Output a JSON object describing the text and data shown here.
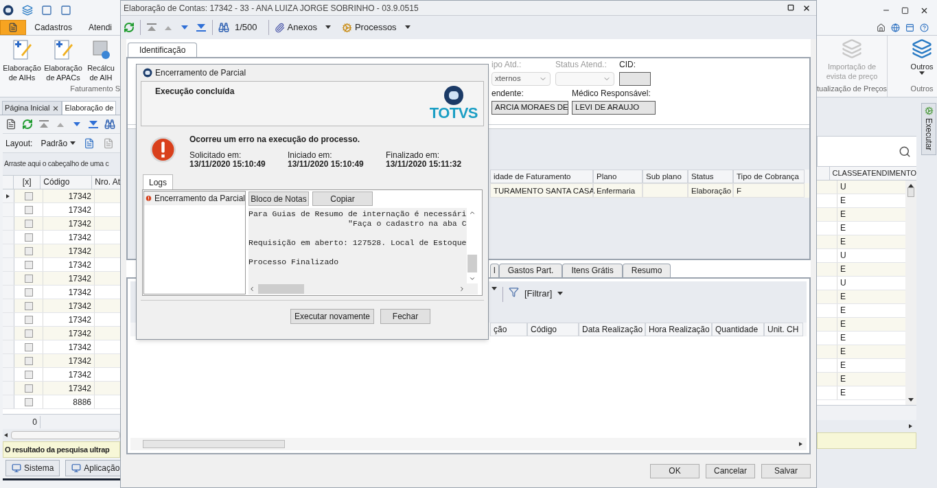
{
  "app": {
    "ribbon_tabs": [
      {
        "label": "Cadastros",
        "selected": false
      },
      {
        "label": "Atendi",
        "selected": false
      }
    ],
    "ribbon_left": {
      "buttons": [
        {
          "label": "Elaboração de AIHs",
          "kind": "sus"
        },
        {
          "label": "Elaboração de APACs",
          "kind": "sus"
        },
        {
          "label": "Recálcu de AIH",
          "kind": "recalc"
        }
      ],
      "group": "Faturamento S"
    },
    "ribbon_right": [
      {
        "button": "Importação de evista de preço",
        "disabled": true,
        "group": "tualização de Preços"
      },
      {
        "button": "Outros",
        "disabled": false,
        "group": "Outros"
      }
    ],
    "doc_tabs": [
      {
        "label": "Página Inicial",
        "selected": false
      },
      {
        "label": "Elaboração de",
        "selected": true
      }
    ],
    "layout": {
      "label": "Layout:",
      "value": "Padrão"
    },
    "group_panel": "Arraste aqui o cabeçalho de uma c",
    "grid": {
      "columns": [
        "[x]",
        "Código",
        "Nro. At"
      ],
      "right_column": "CLASSEATENDIMENTO",
      "rows": [
        {
          "selected": true,
          "checked": false,
          "code": "17342",
          "classe": "U"
        },
        {
          "selected": false,
          "checked": false,
          "code": "17342",
          "classe": "E"
        },
        {
          "selected": false,
          "checked": false,
          "code": "17342",
          "classe": "E"
        },
        {
          "selected": false,
          "checked": false,
          "code": "17342",
          "classe": "E"
        },
        {
          "selected": false,
          "checked": false,
          "code": "17342",
          "classe": "E"
        },
        {
          "selected": false,
          "checked": false,
          "code": "17342",
          "classe": "U"
        },
        {
          "selected": false,
          "checked": false,
          "code": "17342",
          "classe": "E"
        },
        {
          "selected": false,
          "checked": false,
          "code": "17342",
          "classe": "U"
        },
        {
          "selected": false,
          "checked": false,
          "code": "17342",
          "classe": "E"
        },
        {
          "selected": false,
          "checked": false,
          "code": "17342",
          "classe": "E"
        },
        {
          "selected": false,
          "checked": false,
          "code": "17342",
          "classe": "E"
        },
        {
          "selected": false,
          "checked": false,
          "code": "17342",
          "classe": "E"
        },
        {
          "selected": false,
          "checked": false,
          "code": "17342",
          "classe": "E"
        },
        {
          "selected": false,
          "checked": false,
          "code": "17342",
          "classe": "E"
        },
        {
          "selected": false,
          "checked": false,
          "code": "17342",
          "classe": "E"
        },
        {
          "selected": false,
          "checked": false,
          "code": "8886",
          "classe": "E"
        }
      ],
      "footer": "0"
    },
    "status": "O resultado da pesquisa ultrap",
    "taskbar": [
      "Sistema",
      "Aplicação"
    ],
    "side_tab": "Executar"
  },
  "window": {
    "title": "Elaboração de Contas: 17342 - 33 - ANA LUIZA JORGE SOBRINHO - 03.9.0515",
    "toolbar": {
      "counter": "1/500",
      "menus": [
        {
          "label": "Anexos",
          "kind": "clip"
        },
        {
          "label": "Processos",
          "kind": "gear"
        }
      ]
    },
    "tabs": [
      {
        "label": "Identificação",
        "selected": true
      }
    ],
    "fields_row1": [
      {
        "label": "ipo Atd.:",
        "value": "xternos",
        "kind": "combo",
        "disabled": true
      },
      {
        "label": "Status Atend.:",
        "kind": "combo",
        "disabled": true
      },
      {
        "label": "CID:",
        "kind": "text",
        "disabled": false
      }
    ],
    "fields_row2": [
      {
        "label": "endente:",
        "value": "ARCIA MORAES DE",
        "disabled": false
      },
      {
        "label": "Médico Responsável:",
        "value": "LEVI DE ARAUJO",
        "disabled": false
      }
    ],
    "accounts_grid": {
      "columns": [
        "idade de Faturamento",
        "Plano",
        "Sub plano",
        "Status",
        "Tipo de Cobrança"
      ],
      "rows": [
        {
          "cells": [
            "TURAMENTO SANTA CASA",
            "Enfermaria",
            null,
            "Elaboração",
            "F"
          ]
        }
      ]
    },
    "lower_tabs": [
      {
        "label": "l",
        "selected": false
      },
      {
        "label": "Gastos Part.",
        "selected": false
      },
      {
        "label": "Itens Grátis",
        "selected": false
      },
      {
        "label": "Resumo",
        "selected": false
      }
    ],
    "filter": "[Filtrar]",
    "items_grid": {
      "columns": [
        "ção",
        "Código",
        "Data Realização",
        "Hora Realização",
        "Quantidade",
        "Unit. CH"
      ]
    },
    "buttons": [
      "OK",
      "Cancelar",
      "Salvar"
    ]
  },
  "dialog": {
    "title": "Encerramento de Parcial",
    "header": "Execução concluída",
    "logo": "TOTVS",
    "message": "Ocorreu um erro na execução do processo.",
    "times": [
      {
        "label": "Solicitado em:",
        "value": "13/11/2020 15:10:49"
      },
      {
        "label": "Iniciado em:",
        "value": "13/11/2020 15:10:49"
      },
      {
        "label": "Finalizado em:",
        "value": "13/11/2020 15:11:32"
      }
    ],
    "tabs": [
      {
        "label": "Logs",
        "selected": true
      }
    ],
    "log_items": [
      {
        "label": "Encerramento da Parcial",
        "selected": true
      }
    ],
    "log_buttons": [
      "Bloco de Notas",
      "Copiar"
    ],
    "log_lines": [
      {
        "text": "Para Guias de Resumo de internação é necessári",
        "kind": "paragraph"
      },
      {
        "text": "\"Faça o cadastro na aba C",
        "kind": "continuation"
      },
      {
        "text": "Requisição em aberto: 127528. Local de Estoque",
        "kind": "paragraph"
      },
      {
        "text": "Processo Finalizado",
        "kind": "paragraph"
      }
    ],
    "buttons": [
      "Executar novamente",
      "Fechar"
    ]
  }
}
